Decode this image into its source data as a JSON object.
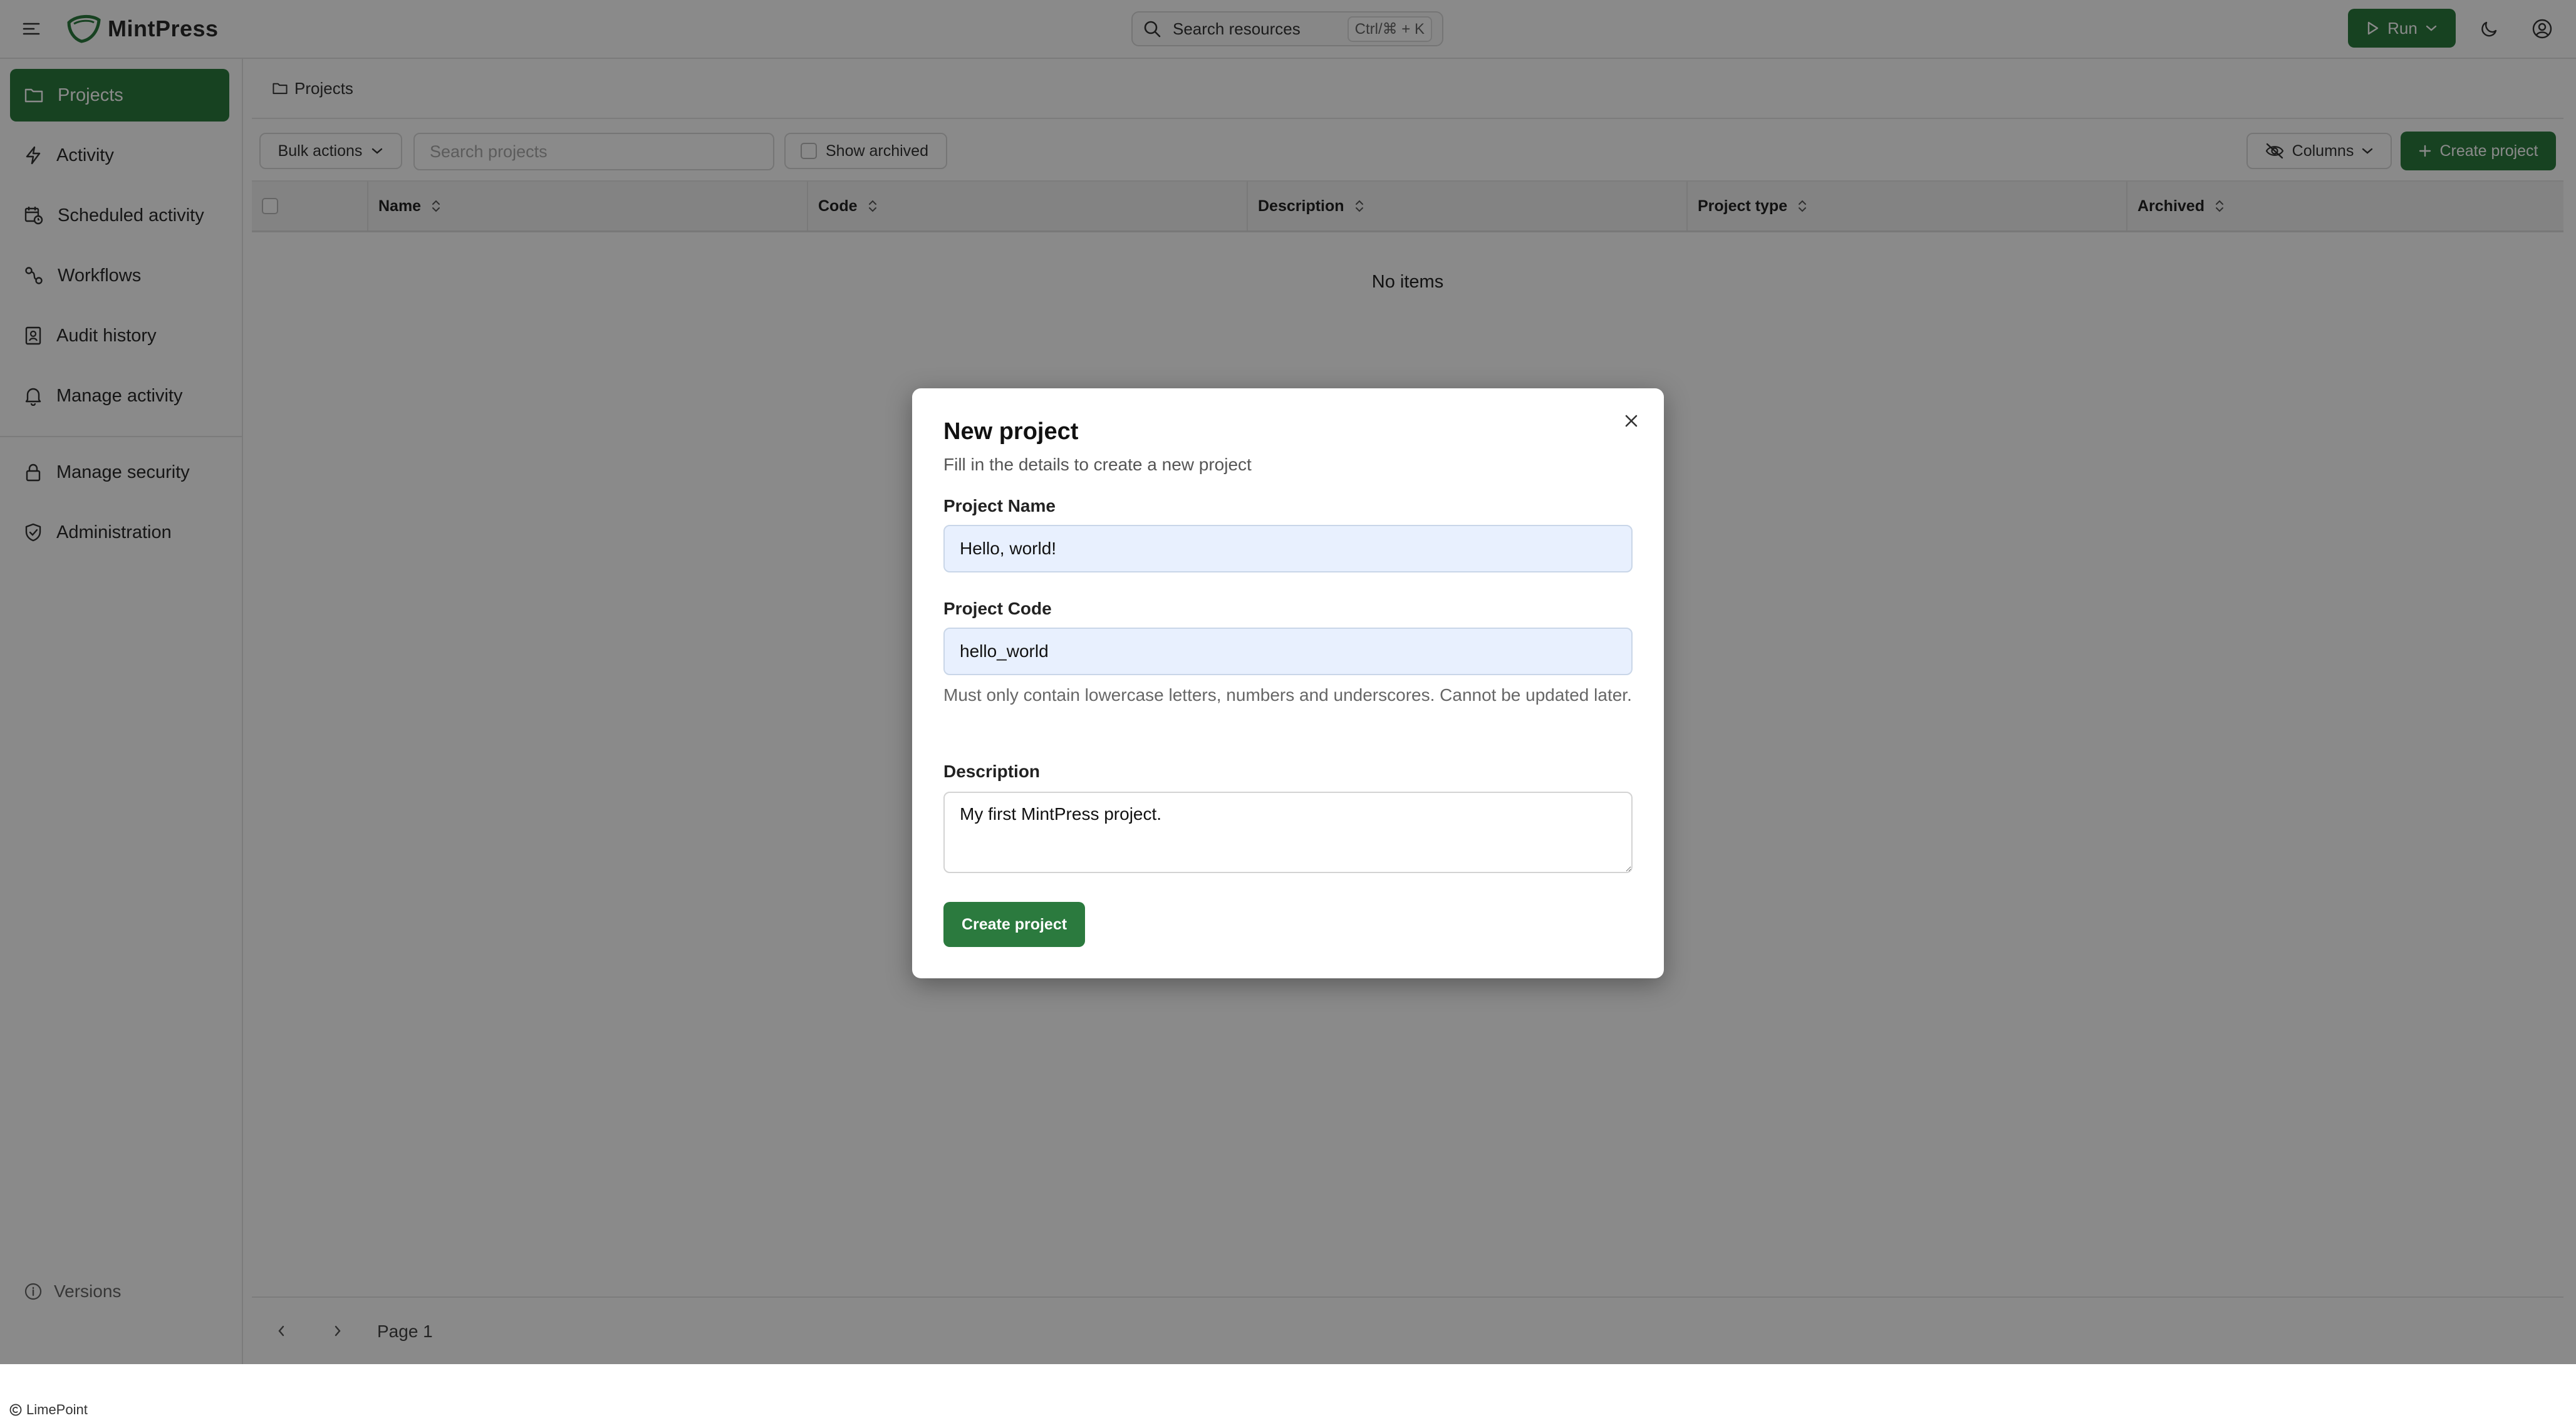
{
  "app": {
    "name": "MintPress",
    "search_placeholder": "Search resources",
    "search_shortcut": "Ctrl/⌘ + K",
    "run_label": "Run"
  },
  "sidebar": {
    "items": [
      {
        "label": "Projects",
        "icon": "folder-icon",
        "active": true
      },
      {
        "label": "Activity",
        "icon": "lightning-icon"
      },
      {
        "label": "Scheduled activity",
        "icon": "calendar-clock-icon"
      },
      {
        "label": "Workflows",
        "icon": "workflow-icon"
      },
      {
        "label": "Audit history",
        "icon": "audit-book-icon"
      },
      {
        "label": "Manage activity",
        "icon": "bell-icon"
      },
      {
        "label": "Manage security",
        "icon": "lock-icon"
      },
      {
        "label": "Administration",
        "icon": "shield-check-icon"
      }
    ],
    "versions_label": "Versions",
    "footer_brand": "LimePoint"
  },
  "breadcrumb": {
    "label": "Projects"
  },
  "toolbar": {
    "bulk_actions": "Bulk actions",
    "search_placeholder": "Search projects",
    "show_archived": "Show archived",
    "columns": "Columns",
    "create_project": "Create project"
  },
  "table": {
    "columns": [
      "Name",
      "Code",
      "Description",
      "Project type",
      "Archived"
    ],
    "empty_text": "No items"
  },
  "pagination": {
    "page_label": "Page 1"
  },
  "modal": {
    "title": "New project",
    "subtitle": "Fill in the details to create a new project",
    "name_label": "Project Name",
    "name_value": "Hello, world!",
    "code_label": "Project Code",
    "code_value": "hello_world",
    "code_help": "Must only contain lowercase letters, numbers and underscores. Cannot be updated later.",
    "description_label": "Description",
    "description_value": "My first MintPress project.",
    "submit_label": "Create project"
  },
  "colors": {
    "brand_green": "#2b7a3e",
    "input_fill": "#e8f0fe"
  }
}
